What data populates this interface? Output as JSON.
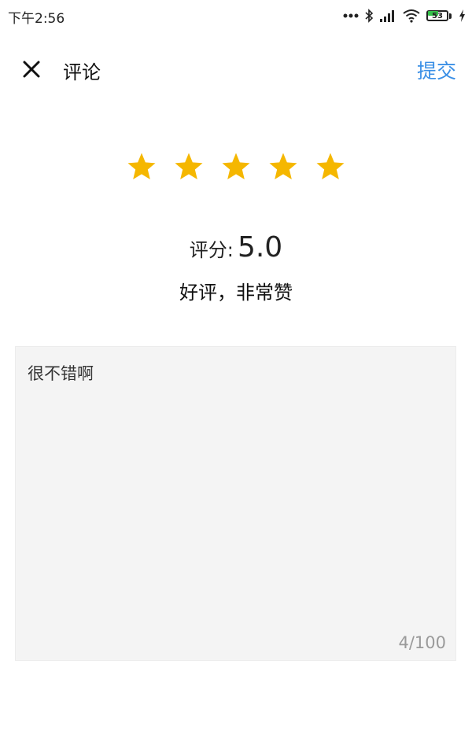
{
  "status_bar": {
    "time": "下午2:56",
    "battery_level": "53",
    "icons": [
      "dots-icon",
      "bluetooth-icon",
      "signal-icon",
      "wifi-icon",
      "battery-icon",
      "charging-icon"
    ]
  },
  "nav": {
    "close_icon": "close-icon",
    "title": "评论",
    "submit_label": "提交"
  },
  "rating": {
    "stars_filled": 5,
    "stars_total": 5,
    "score_label": "评分:",
    "score_value": "5.0",
    "description": "好评，非常赞"
  },
  "comment": {
    "value": "很不错啊",
    "char_count": "4/100"
  },
  "colors": {
    "accent": "#3a8fe6",
    "star": "#f5b700",
    "input_bg": "#f4f4f4"
  }
}
